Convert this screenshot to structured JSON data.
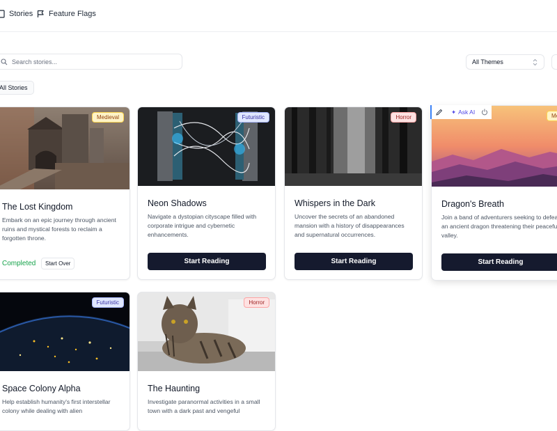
{
  "nav": {
    "stories": "Stories",
    "feature_flags": "Feature Flags"
  },
  "search": {
    "placeholder": "Search stories..."
  },
  "filter": {
    "theme_selected": "All Themes"
  },
  "tabs": {
    "all": "All Stories"
  },
  "ai_toolbar": {
    "ask_ai": "Ask AI"
  },
  "colors": {
    "primary_button": "#151a2e",
    "completed": "#16a34a",
    "accent": "#4f46e5"
  },
  "cards": [
    {
      "title": "The Lost Kingdom",
      "badge": "Medieval",
      "description": "Embark on an epic journey through ancient ruins and mystical forests to reclaim a forgotten throne.",
      "status": "Completed",
      "action": "Start Over"
    },
    {
      "title": "Neon Shadows",
      "badge": "Futuristic",
      "description": "Navigate a dystopian cityscape filled with corporate intrigue and cybernetic enhancements.",
      "action": "Start Reading"
    },
    {
      "title": "Whispers in the Dark",
      "badge": "Horror",
      "description": "Uncover the secrets of an abandoned mansion with a history of disappearances and supernatural occurrences.",
      "action": "Start Reading"
    },
    {
      "title": "Dragon's Breath",
      "badge": "Medieval",
      "description": "Join a band of adventurers seeking to defeat an ancient dragon threatening their peaceful valley.",
      "action": "Start Reading"
    },
    {
      "title": "Space Colony Alpha",
      "badge": "Futuristic",
      "description": "Help establish humanity's first interstellar colony while dealing with alien"
    },
    {
      "title": "The Haunting",
      "badge": "Horror",
      "description": "Investigate paranormal activities in a small town with a dark past and vengeful"
    }
  ]
}
